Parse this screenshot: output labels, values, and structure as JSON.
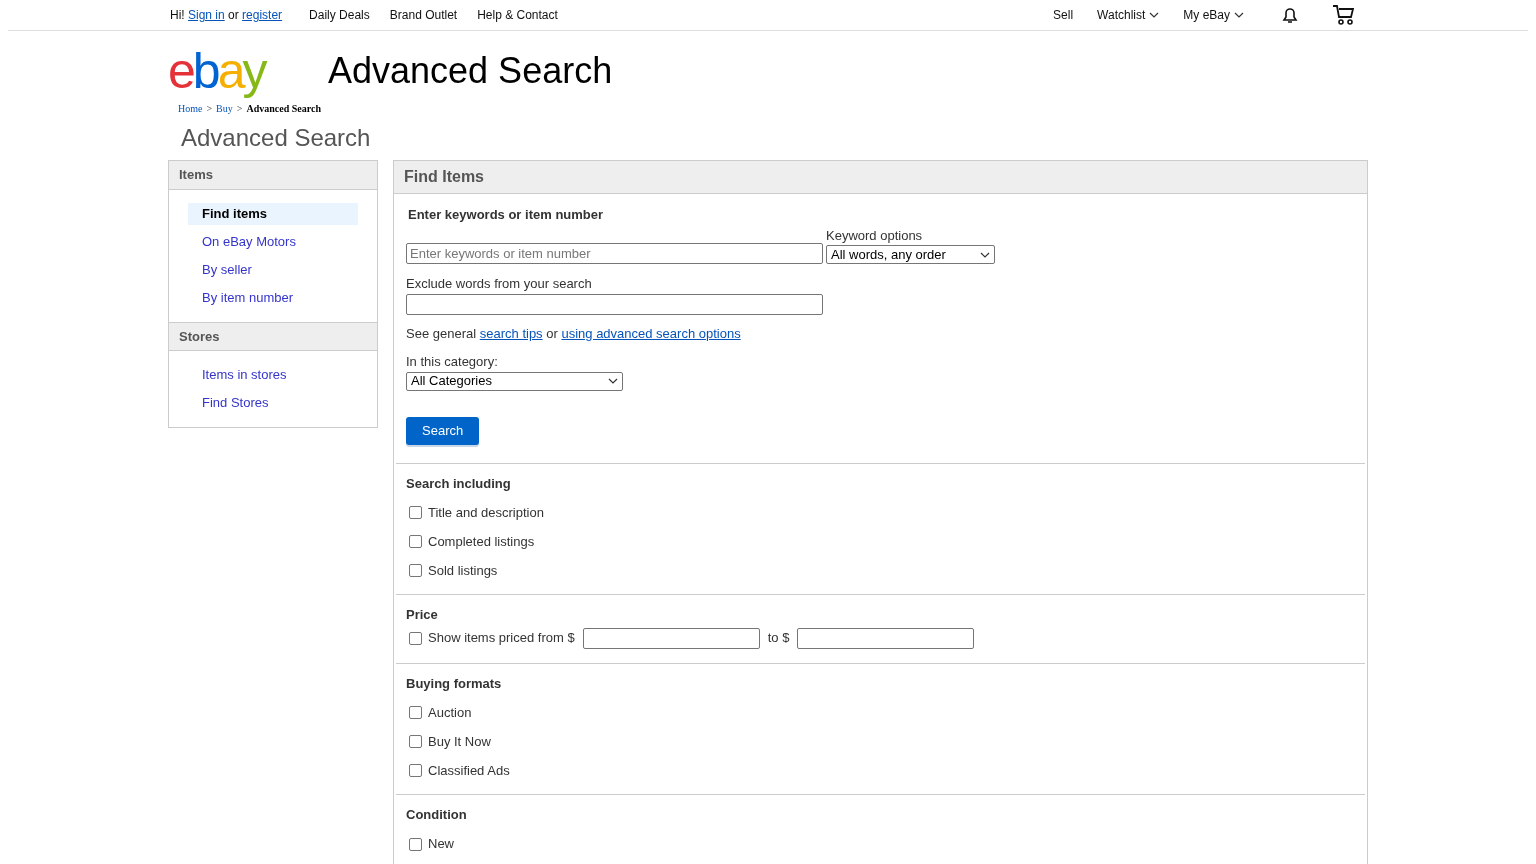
{
  "top_nav": {
    "greeting": "Hi!",
    "sign_in": "Sign in",
    "or": "or",
    "register": "register",
    "links": [
      "Daily Deals",
      "Brand Outlet",
      "Help & Contact"
    ],
    "right_links": [
      {
        "label": "Sell",
        "dropdown": false
      },
      {
        "label": "Watchlist",
        "dropdown": true
      },
      {
        "label": "My eBay",
        "dropdown": true
      }
    ]
  },
  "logo": [
    {
      "char": "e",
      "color": "#e53238"
    },
    {
      "char": "b",
      "color": "#0064d2"
    },
    {
      "char": "a",
      "color": "#f5af02"
    },
    {
      "char": "y",
      "color": "#86b817"
    }
  ],
  "page_title": "Advanced Search",
  "breadcrumb": [
    {
      "label": "Home",
      "current": false
    },
    {
      "label": "Buy",
      "current": false
    },
    {
      "label": "Advanced Search",
      "current": true
    }
  ],
  "breadcrumb_separator": ">",
  "heading": "Advanced Search",
  "sidebar": [
    {
      "title": "Items",
      "items": [
        {
          "label": "Find items",
          "selected": true
        },
        {
          "label": "On eBay Motors",
          "selected": false
        },
        {
          "label": "By seller",
          "selected": false
        },
        {
          "label": "By item number",
          "selected": false
        }
      ]
    },
    {
      "title": "Stores",
      "items": [
        {
          "label": "Items in stores",
          "selected": false
        },
        {
          "label": "Find Stores",
          "selected": false
        }
      ]
    }
  ],
  "find_items": {
    "title": "Find Items",
    "keywords_label": "Enter keywords or item number",
    "keywords_placeholder": "Enter keywords or item number",
    "keyword_options_label": "Keyword options",
    "keyword_option_value": "All words, any order",
    "exclude_label": "Exclude words from your search",
    "tips_prefix": "See general",
    "tips_link": "search tips",
    "tips_or": "or",
    "tips_link2": "using advanced search options",
    "category_label": "In this category:",
    "category_value": "All Categories",
    "search_button": "Search"
  },
  "sections": [
    {
      "kind": "checkboxes",
      "title": "Search including",
      "options": [
        {
          "label": "Title and description",
          "checked": false
        },
        {
          "label": "Completed listings",
          "checked": false
        },
        {
          "label": "Sold listings",
          "checked": false
        }
      ]
    },
    {
      "kind": "price",
      "title": "Price",
      "option": {
        "label": "Show items priced from $",
        "checked": false
      },
      "to_label": "to $"
    },
    {
      "kind": "checkboxes",
      "title": "Buying formats",
      "options": [
        {
          "label": "Auction",
          "checked": false
        },
        {
          "label": "Buy It Now",
          "checked": false
        },
        {
          "label": "Classified Ads",
          "checked": false
        }
      ]
    },
    {
      "kind": "checkboxes",
      "title": "Condition",
      "options": [
        {
          "label": "New",
          "checked": false
        }
      ]
    }
  ]
}
